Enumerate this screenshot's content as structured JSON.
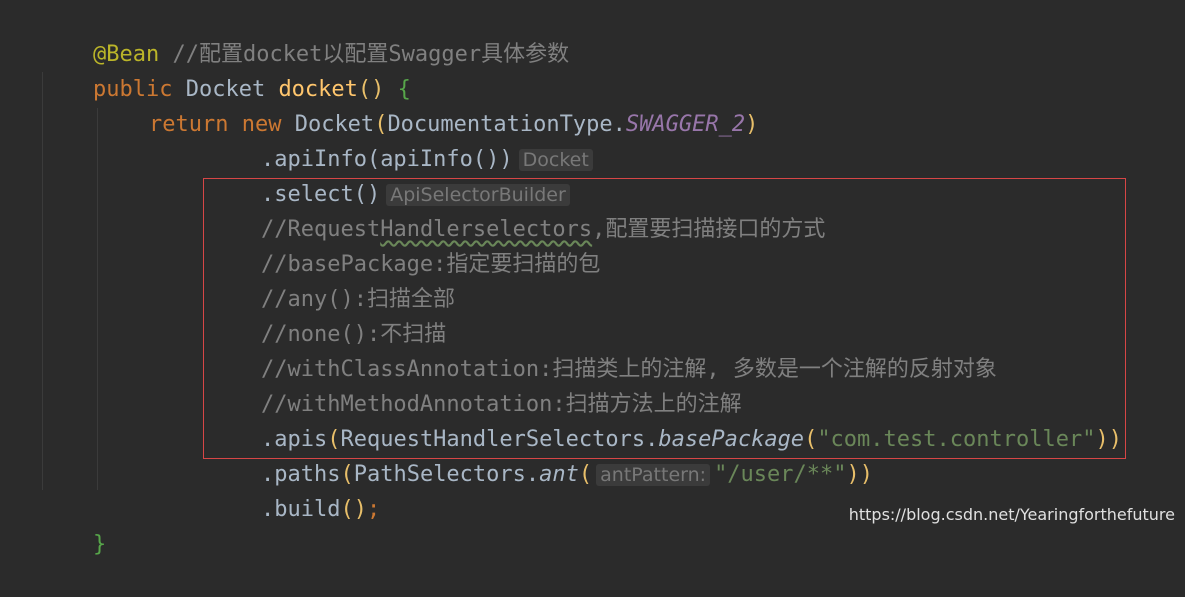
{
  "code": {
    "l1_annotation": "@Bean",
    "l1_comment": " //配置docket以配置Swagger具体参数",
    "l2_kw": "public",
    "l2_type": " Docket ",
    "l2_fn": "docket",
    "l2_parens": "()",
    "l2_brace": " {",
    "l3_kw_return": "return",
    "l3_kw_new": " new ",
    "l3_type": "Docket",
    "l3_paren_open": "(",
    "l3_arg": "DocumentationType.",
    "l3_static": "SWAGGER_2",
    "l3_paren_close": ")",
    "l4_call": ".apiInfo(apiInfo())",
    "l4_hint": "Docket",
    "l5_call": ".select()",
    "l5_hint": "ApiSelectorBuilder",
    "l6_comment_a": "//Request",
    "l6_comment_b": "Handlerselectors",
    "l6_comment_c": ",配置要扫描接口的方式",
    "l7_comment": "//basePackage:指定要扫描的包",
    "l8_comment": "//any():扫描全部",
    "l9_comment": "//none():不扫描",
    "l10_comment": "//withClassAnnotation:扫描类上的注解, 多数是一个注解的反射对象",
    "l11_comment": "//withMethodAnnotation:扫描方法上的注解",
    "l12_a": ".apis",
    "l12_paren_open": "(",
    "l12_b": "RequestHandlerSelectors.",
    "l12_method": "basePackage",
    "l12_paren2_open": "(",
    "l12_str": "\"com.test.controller\"",
    "l12_close": "))",
    "l13_a": ".paths",
    "l13_paren_open": "(",
    "l13_b": "PathSelectors.",
    "l13_method": "ant",
    "l13_paren2_open": "(",
    "l13_hint": "antPattern:",
    "l13_str": "\"/user/**\"",
    "l13_close": "))",
    "l14_call": ".build",
    "l14_parens": "()",
    "l14_semi": ";",
    "l15_brace": "}"
  },
  "watermark": "https://blog.csdn.net/Yearingforthefuture",
  "colors": {
    "background": "#2b2b2b",
    "keyword": "#cc7832",
    "annotation": "#bbb529",
    "comment": "#808080",
    "function": "#ffc66d",
    "static_field": "#9876aa",
    "string": "#6a8759",
    "highlight_border": "#d64646"
  }
}
